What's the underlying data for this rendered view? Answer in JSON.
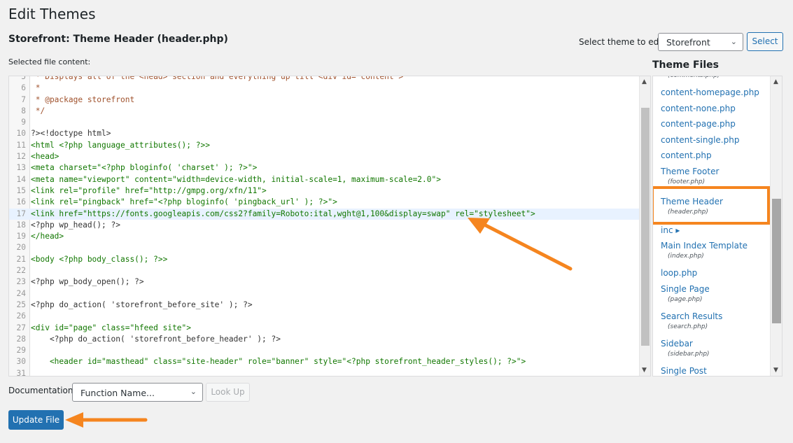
{
  "page": {
    "title": "Edit Themes",
    "file_heading": "Storefront: Theme Header (header.php)",
    "selected_label": "Selected file content:"
  },
  "theme_select": {
    "label": "Select theme to edit:",
    "value": "Storefront",
    "button": "Select"
  },
  "theme_files": {
    "heading": "Theme Files",
    "items": [
      {
        "label": "",
        "sub": "(comments.php)"
      },
      {
        "label": "content-homepage.php",
        "sub": ""
      },
      {
        "label": "content-none.php",
        "sub": ""
      },
      {
        "label": "content-page.php",
        "sub": ""
      },
      {
        "label": "content-single.php",
        "sub": ""
      },
      {
        "label": "content.php",
        "sub": ""
      },
      {
        "label": "Theme Footer",
        "sub": "(footer.php)"
      },
      {
        "label": "Theme Header",
        "sub": "(header.php)",
        "active": true
      },
      {
        "label": "inc ▸",
        "sub": ""
      },
      {
        "label": "Main Index Template",
        "sub": "(index.php)"
      },
      {
        "label": "loop.php",
        "sub": ""
      },
      {
        "label": "Single Page",
        "sub": "(page.php)"
      },
      {
        "label": "Search Results",
        "sub": "(search.php)"
      },
      {
        "label": "Sidebar",
        "sub": "(sidebar.php)"
      },
      {
        "label": "Single Post",
        "sub": ""
      }
    ]
  },
  "editor": {
    "lines": [
      {
        "n": "5",
        "text": " * Displays all of the <head> section and everything up till <div id=\"content\">"
      },
      {
        "n": "6",
        "text": " *"
      },
      {
        "n": "7",
        "text": " * @package storefront"
      },
      {
        "n": "8",
        "text": " */"
      },
      {
        "n": "9",
        "text": ""
      },
      {
        "n": "10",
        "text": "?><!doctype html>"
      },
      {
        "n": "11",
        "text": "<html <?php language_attributes(); ?>>"
      },
      {
        "n": "12",
        "text": "<head>"
      },
      {
        "n": "13",
        "text": "<meta charset=\"<?php bloginfo( 'charset' ); ?>\">"
      },
      {
        "n": "14",
        "text": "<meta name=\"viewport\" content=\"width=device-width, initial-scale=1, maximum-scale=2.0\">"
      },
      {
        "n": "15",
        "text": "<link rel=\"profile\" href=\"http://gmpg.org/xfn/11\">"
      },
      {
        "n": "16",
        "text": "<link rel=\"pingback\" href=\"<?php bloginfo( 'pingback_url' ); ?>\">"
      },
      {
        "n": "17",
        "text": "<link href=\"https://fonts.googleapis.com/css2?family=Roboto:ital,wght@1,100&display=swap\" rel=\"stylesheet\">"
      },
      {
        "n": "18",
        "text": "<?php wp_head(); ?>"
      },
      {
        "n": "19",
        "text": "</head>"
      },
      {
        "n": "20",
        "text": ""
      },
      {
        "n": "21",
        "text": "<body <?php body_class(); ?>>"
      },
      {
        "n": "22",
        "text": ""
      },
      {
        "n": "23",
        "text": "<?php wp_body_open(); ?>"
      },
      {
        "n": "24",
        "text": ""
      },
      {
        "n": "25",
        "text": "<?php do_action( 'storefront_before_site' ); ?>"
      },
      {
        "n": "26",
        "text": ""
      },
      {
        "n": "27",
        "text": "<div id=\"page\" class=\"hfeed site\">"
      },
      {
        "n": "28",
        "text": "    <?php do_action( 'storefront_before_header' ); ?>"
      },
      {
        "n": "29",
        "text": ""
      },
      {
        "n": "30",
        "text": "    <header id=\"masthead\" class=\"site-header\" role=\"banner\" style=\"<?php storefront_header_styles(); ?>\">"
      },
      {
        "n": "31",
        "text": ""
      }
    ],
    "highlight_line": "17"
  },
  "documentation": {
    "label": "Documentation:",
    "select_value": "Function Name...",
    "lookup_button": "Look Up"
  },
  "update_button": "Update File",
  "colors": {
    "accent": "#2271b1",
    "annotation": "#f5851f"
  }
}
